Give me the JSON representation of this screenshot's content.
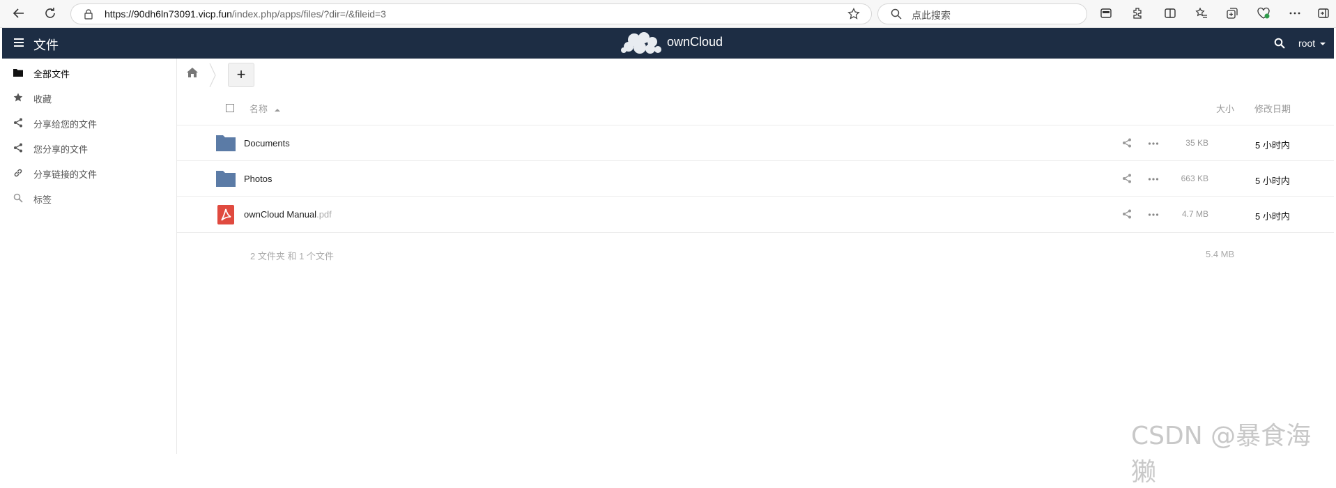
{
  "browser": {
    "url_host": "https://90dh6ln73091.vicp.fun",
    "url_path": "/index.php/apps/files/?dir=/&fileid=3",
    "search_placeholder": "点此搜索"
  },
  "header": {
    "app_title": "文件",
    "brand": "ownCloud",
    "user": "root"
  },
  "sidebar": {
    "items": [
      {
        "label": "全部文件",
        "icon": "folder-icon"
      },
      {
        "label": "收藏",
        "icon": "star-icon"
      },
      {
        "label": "分享给您的文件",
        "icon": "share-icon"
      },
      {
        "label": "您分享的文件",
        "icon": "share-icon"
      },
      {
        "label": "分享链接的文件",
        "icon": "link-icon"
      },
      {
        "label": "标签",
        "icon": "tag-search-icon"
      }
    ]
  },
  "toolbar": {
    "new_label": "+"
  },
  "table": {
    "headers": {
      "name": "名称",
      "size": "大小",
      "modified": "修改日期"
    },
    "rows": [
      {
        "name": "Documents",
        "ext": "",
        "type": "folder",
        "size": "35 KB",
        "modified": "5 小时内"
      },
      {
        "name": "Photos",
        "ext": "",
        "type": "folder",
        "size": "663 KB",
        "modified": "5 小时内"
      },
      {
        "name": "ownCloud Manual",
        "ext": ".pdf",
        "type": "pdf",
        "size": "4.7 MB",
        "modified": "5 小时内"
      }
    ],
    "summary": {
      "text": "2 文件夹 和 1 个文件",
      "total_size": "5.4 MB"
    }
  },
  "watermark": "CSDN @暴食海獭",
  "colors": {
    "header_bg": "#1d2d44",
    "folder": "#5b7ba6",
    "pdf": "#e04a3f"
  }
}
